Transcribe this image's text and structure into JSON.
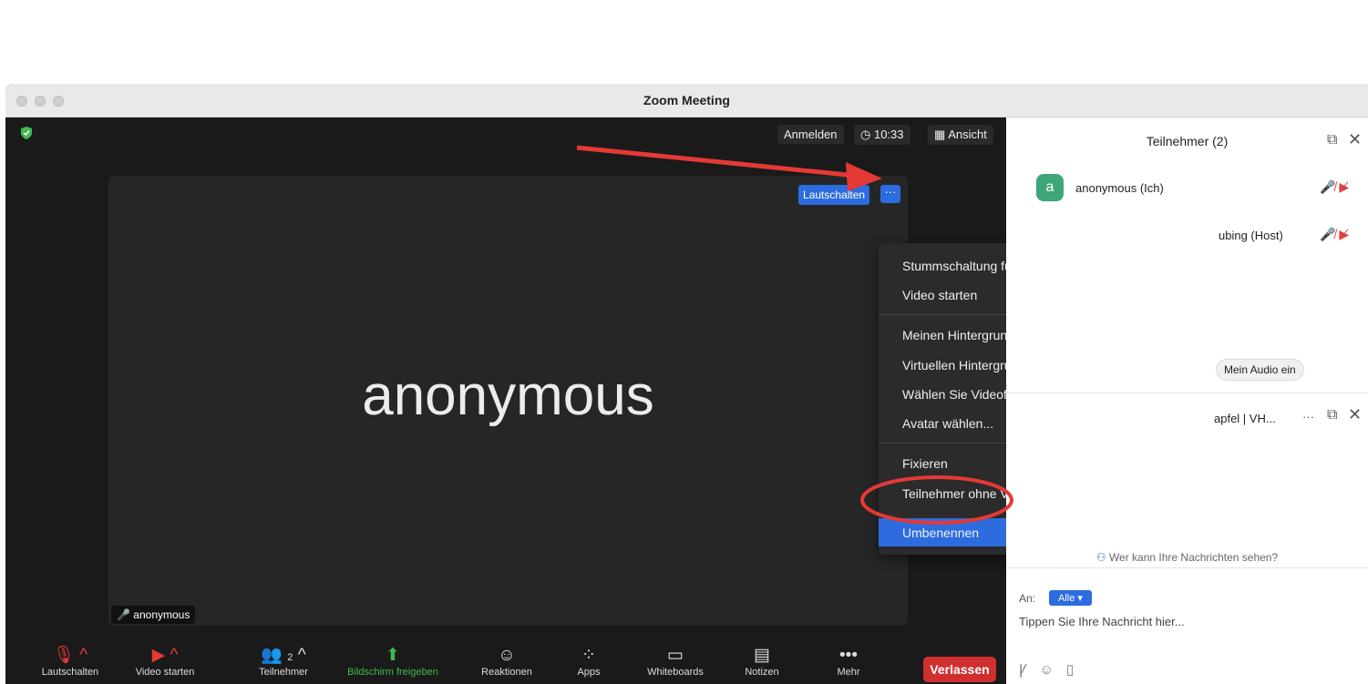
{
  "window": {
    "title": "Zoom Meeting"
  },
  "topbar": {
    "signin": "Anmelden",
    "time": "10:33",
    "view": "Ansicht"
  },
  "tile": {
    "big_name": "anonymous",
    "unmute_button": "Lautschalten",
    "more_button": "···",
    "name_badge": "anonymous"
  },
  "context_menu": {
    "items": [
      "Stummschaltung für Audio aufheben",
      "Video starten",
      "Meinen Hintergrund verwischen",
      "Virtuellen Hintergrund wählen ...",
      "Wählen Sie Videofilter ...",
      "Avatar wählen...",
      "Fixieren",
      "Teilnehmer ohne Videoübertragung anzeigen",
      "Umbenennen"
    ],
    "highlighted": "Umbenennen"
  },
  "toolbar": {
    "items": [
      {
        "label": "Lautschalten",
        "icon": "mic-muted-icon"
      },
      {
        "label": "Video starten",
        "icon": "video-off-icon"
      },
      {
        "label": "Teilnehmer",
        "icon": "participants-icon",
        "count": "2"
      },
      {
        "label": "Bildschirm freigeben",
        "icon": "share-icon"
      },
      {
        "label": "Reaktionen",
        "icon": "reaction-icon"
      },
      {
        "label": "Apps",
        "icon": "apps-icon"
      },
      {
        "label": "Whiteboards",
        "icon": "whiteboard-icon"
      },
      {
        "label": "Notizen",
        "icon": "notes-icon"
      },
      {
        "label": "Mehr",
        "icon": "more-icon"
      }
    ],
    "leave": "Verlassen"
  },
  "participants_panel": {
    "title": "Teilnehmer (2)",
    "participants": [
      {
        "initial": "a",
        "name": "anonymous (Ich)"
      },
      {
        "name": "ubing (Host)"
      }
    ],
    "audio_button": "Mein Audio ein"
  },
  "chat_panel": {
    "title": "apfel | VH...",
    "who_can_see": "Wer kann Ihre Nachrichten sehen?",
    "to_label": "An:",
    "to_value": "Alle",
    "placeholder": "Tippen Sie Ihre Nachricht hier..."
  },
  "colors": {
    "accent": "#2d6cdf",
    "leave": "#d02f2f",
    "annotation": "#e53935"
  }
}
